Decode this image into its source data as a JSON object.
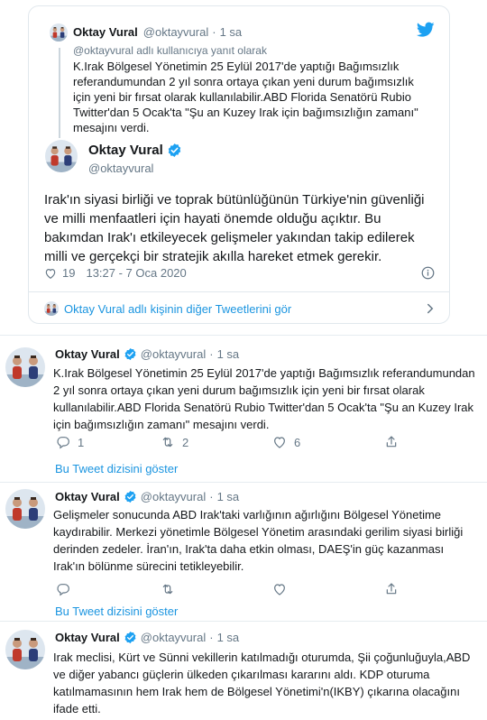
{
  "embed": {
    "quoted": {
      "author_name": "Oktay Vural",
      "handle": "@oktayvural",
      "separator": "·",
      "time": "1 sa",
      "reply_context": "@oktayvural adlı kullanıcıya yanıt olarak",
      "text": "K.Irak Bölgesel Yönetimin 25 Eylül 2017'de yaptığı Bağımsızlık referandumundan 2 yıl sonra ortaya çıkan yeni durum bağımsızlık için yeni bir fırsat olarak kullanılabilir.ABD Florida Senatörü Rubio Twitter'dan 5 Ocak'ta \"Şu an Kuzey Irak için bağımsızlığın zamanı\" mesajını verdi."
    },
    "main": {
      "author_name": "Oktay Vural",
      "handle": "@oktayvural",
      "text": "Irak'ın siyasi birliği ve toprak bütünlüğünün Türkiye'nin güvenliği ve milli menfaatleri için hayati önemde olduğu açıktır. Bu bakımdan Irak'ı etkileyecek gelişmeler yakından takip edilerek milli ve gerçekçi bir stratejik akılla hareket etmek gerekir.",
      "likes": "19",
      "timestamp": "13:27 - 7 Oca 2020"
    },
    "more_link": "Oktay Vural adlı kişinin diğer Tweetlerini gör"
  },
  "timeline": [
    {
      "author_name": "Oktay Vural",
      "handle": "@oktayvural",
      "separator": "·",
      "time": "1 sa",
      "text": "K.Irak Bölgesel Yönetimin 25 Eylül 2017'de yaptığı Bağımsızlık referandumundan 2 yıl sonra ortaya çıkan yeni durum bağımsızlık için yeni bir fırsat olarak kullanılabilir.ABD Florida Senatörü Rubio Twitter'dan 5 Ocak'ta \"Şu an Kuzey Irak için bağımsızlığın zamanı\" mesajını verdi.",
      "replies": "1",
      "retweets": "2",
      "likes": "6",
      "show_thread": "Bu Tweet dizisini göster"
    },
    {
      "author_name": "Oktay Vural",
      "handle": "@oktayvural",
      "separator": "·",
      "time": "1 sa",
      "text": "Gelişmeler sonucunda ABD Irak'taki varlığının ağırlığını Bölgesel Yönetime kaydırabilir. Merkezi yönetimle Bölgesel Yönetim arasındaki gerilim siyasi birliği derinden zedeler. İran'ın, Irak'ta daha etkin olması, DAEŞ'in güç kazanması Irak'ın bölünme sürecini tetikleyebilir.",
      "replies": "",
      "retweets": "",
      "likes": "",
      "show_thread": "Bu Tweet dizisini göster"
    },
    {
      "author_name": "Oktay Vural",
      "handle": "@oktayvural",
      "separator": "·",
      "time": "1 sa",
      "text": "Irak meclisi, Kürt ve Sünni vekillerin katılmadığı oturumda, Şii çoğunluğuyla,ABD ve diğer yabancı güçlerin ülkeden çıkarılması kararını aldı. KDP oturuma katılmamasının hem Irak hem de Bölgesel Yönetimi'n(IKBY) çıkarına olacağını ifade etti."
    }
  ],
  "icons": {
    "twitter_bird": "twitter-bird-icon",
    "verified": "verified-badge-icon",
    "heart": "heart-icon",
    "info": "info-icon",
    "reply": "reply-icon",
    "retweet": "retweet-icon",
    "share": "share-icon",
    "chevron": "chevron-right-icon"
  },
  "colors": {
    "accent": "#1da1f2",
    "link": "#1b95e0",
    "muted": "#657786",
    "border": "#e1e8ed"
  }
}
